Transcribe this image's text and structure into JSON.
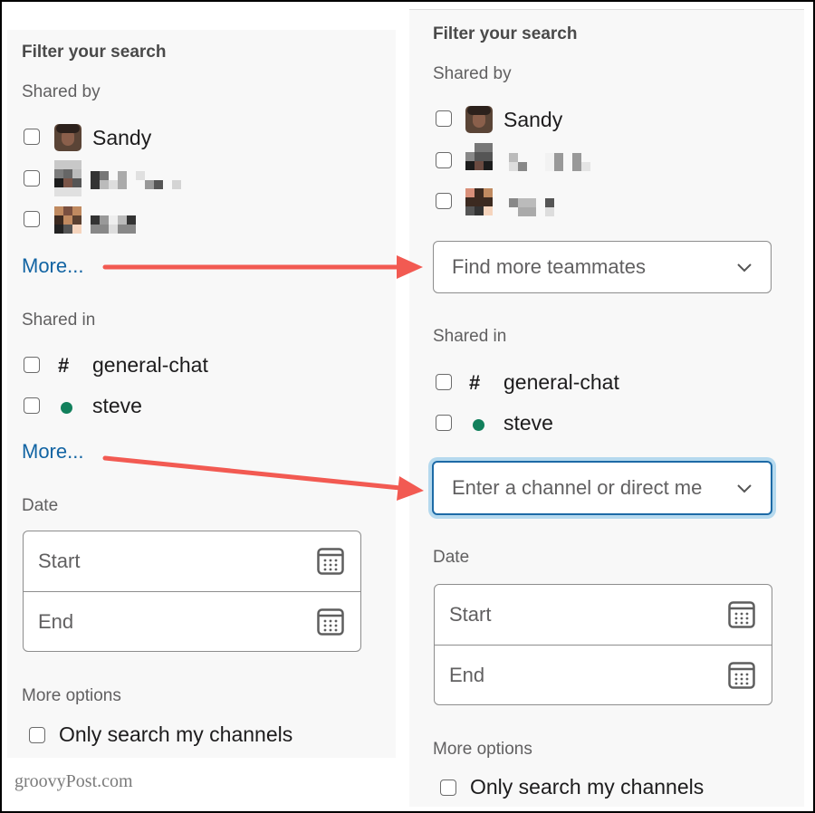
{
  "left_panel": {
    "title": "Filter your search",
    "shared_by": {
      "heading": "Shared by",
      "people": [
        {
          "name": "Sandy",
          "avatar": "photo"
        },
        {
          "name": "[redacted]",
          "avatar": "pixelated"
        },
        {
          "name": "[redacted]",
          "avatar": "pixelated"
        }
      ],
      "more_link": "More..."
    },
    "shared_in": {
      "heading": "Shared in",
      "channels": [
        {
          "icon": "hash-icon",
          "glyph": "#",
          "name": "general-chat"
        },
        {
          "icon": "presence-dot-icon",
          "glyph": "●",
          "name": "steve"
        }
      ],
      "more_link": "More..."
    },
    "date": {
      "heading": "Date",
      "start_placeholder": "Start",
      "end_placeholder": "End"
    },
    "more_options": {
      "heading": "More options",
      "checkbox_label": "Only search my channels"
    }
  },
  "right_panel": {
    "title": "Filter your search",
    "shared_by": {
      "heading": "Shared by",
      "people": [
        {
          "name": "Sandy",
          "avatar": "photo"
        },
        {
          "name": "[redacted]",
          "avatar": "pixelated"
        },
        {
          "name": "[redacted]",
          "avatar": "pixelated"
        }
      ],
      "select_placeholder": "Find more teammates"
    },
    "shared_in": {
      "heading": "Shared in",
      "channels": [
        {
          "icon": "hash-icon",
          "glyph": "#",
          "name": "general-chat"
        },
        {
          "icon": "presence-dot-icon",
          "glyph": "●",
          "name": "steve"
        }
      ],
      "select_placeholder": "Enter a channel or direct me"
    },
    "date": {
      "heading": "Date",
      "start_placeholder": "Start",
      "end_placeholder": "End"
    },
    "more_options": {
      "heading": "More options",
      "checkbox_label": "Only search my channels"
    }
  },
  "annotations": {
    "arrow_color": "#f25a52",
    "arrows": [
      {
        "from": "left_panel.shared_by.more_link",
        "to": "right_panel.shared_by.select"
      },
      {
        "from": "left_panel.shared_in.more_link",
        "to": "right_panel.shared_in.select"
      }
    ]
  },
  "colors": {
    "link": "#1264a3",
    "presence_active": "#12805c",
    "focus_ring": "#b5d9ee",
    "focus_border": "#1d6aa6",
    "panel_bg": "#f8f8f8"
  },
  "watermark": "groovyPost.com"
}
